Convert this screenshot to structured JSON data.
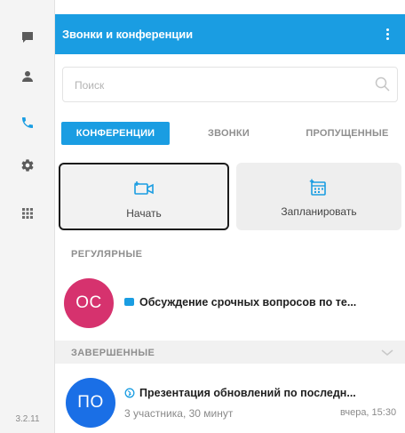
{
  "sidebar": {
    "icons": [
      {
        "name": "chat-icon"
      },
      {
        "name": "contacts-icon"
      },
      {
        "name": "phone-icon",
        "active": true
      },
      {
        "name": "settings-icon"
      },
      {
        "name": "apps-grid-icon"
      }
    ],
    "version": "3.2.11"
  },
  "header": {
    "title": "Звонки и конференции",
    "menu_icon": "more-vertical-icon"
  },
  "search": {
    "placeholder": "Поиск",
    "icon": "search-icon"
  },
  "tabs": [
    {
      "label": "КОНФЕРЕНЦИИ",
      "active": true
    },
    {
      "label": "ЗВОНКИ",
      "active": false
    },
    {
      "label": "ПРОПУЩЕННЫЕ",
      "active": false
    }
  ],
  "actions": {
    "start": {
      "label": "Начать",
      "icon": "video-add-icon"
    },
    "schedule": {
      "label": "Запланировать",
      "icon": "calendar-add-icon"
    }
  },
  "sections": {
    "regular": {
      "label": "РЕГУЛЯРНЫЕ",
      "items": [
        {
          "initials": "ОС",
          "title": "Обсуждение срочных вопросов по те...",
          "status_icon": "status-square-icon",
          "avatar_color": "#d6326e"
        }
      ]
    },
    "finished": {
      "label": "ЗАВЕРШЕННЫЕ",
      "items": [
        {
          "initials": "ПО",
          "title": "Презентация обновлений по последн...",
          "status_icon": "globe-icon",
          "subtitle": "3 участника, 30 минут",
          "time": "вчера, 15:30",
          "avatar_color": "#1a6fe6"
        }
      ]
    }
  },
  "colors": {
    "accent": "#1a9de2",
    "sidebar_bg": "#f4f4f4",
    "section_bg": "#f1f1f1"
  }
}
